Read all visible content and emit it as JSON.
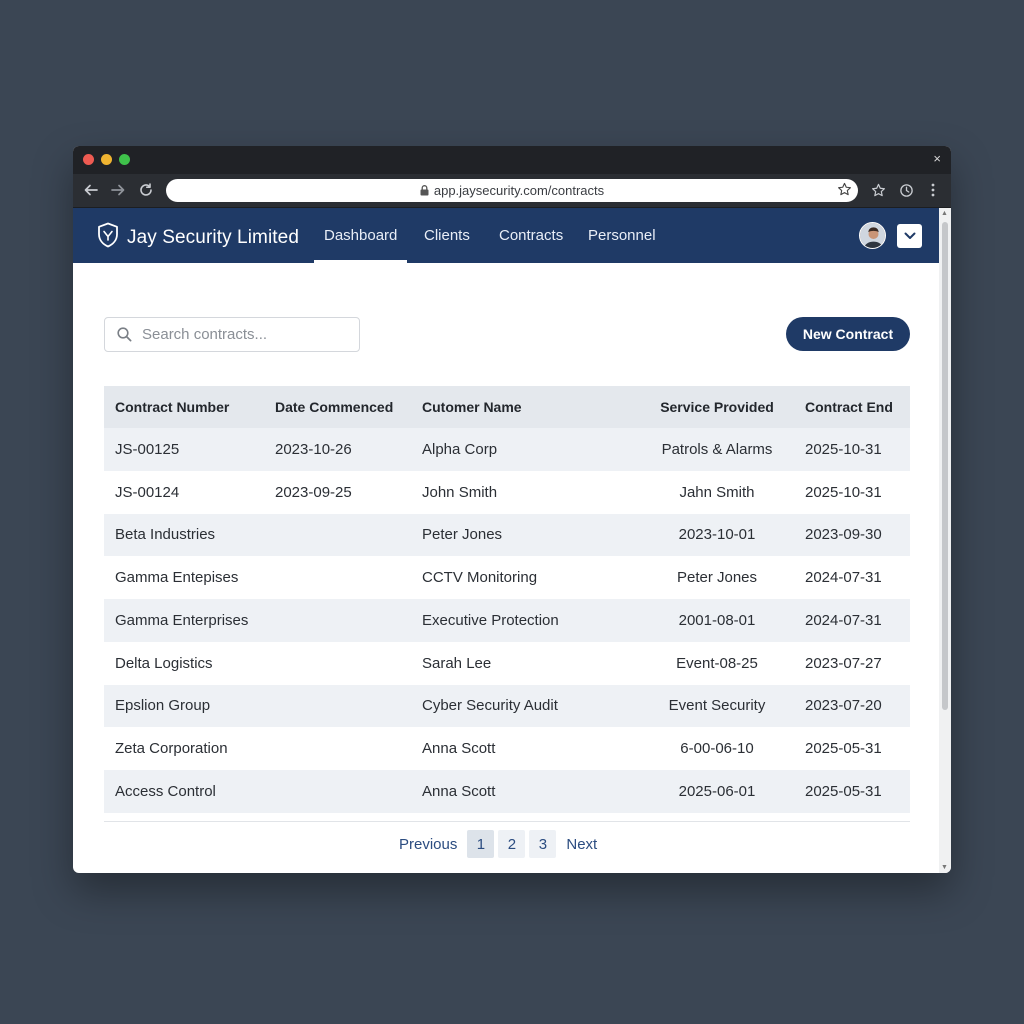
{
  "browser": {
    "url": "app.jaysecurity.com/contracts",
    "close_glyph": "×",
    "icons": [
      "back-arrow-icon",
      "forward-arrow-icon",
      "reload-icon",
      "lock-icon",
      "star-icon",
      "bookmark-star-icon",
      "history-icon",
      "kebab-menu-icon"
    ]
  },
  "navbar": {
    "brand": "Jay Security Limited",
    "links": [
      "Dashboard",
      "Clients",
      "Contracts",
      "Personnel"
    ],
    "active": "Dashboard"
  },
  "search": {
    "placeholder": "Search contracts..."
  },
  "actions": {
    "new_contract": "New Contract"
  },
  "table": {
    "headers": [
      "Contract Number",
      "Date Commenced",
      "Cutomer Name",
      "Service Provided",
      "Contract End"
    ],
    "rows": [
      [
        "JS-00125",
        "2023-10-26",
        "Alpha Corp",
        "Patrols & Alarms",
        "2025-10-31"
      ],
      [
        "JS-00124",
        "2023-09-25",
        "John Smith",
        "Jahn Smith",
        "2025-10-31"
      ],
      [
        "Beta Industries",
        "",
        "Peter Jones",
        "2023-10-01",
        "2023-09-30"
      ],
      [
        "Gamma Entepises",
        "",
        "CCTV Monitoring",
        "Peter Jones",
        "2024-07-31"
      ],
      [
        "Gamma Enterprises",
        "",
        "Executive Protection",
        "2001-08-01",
        "2024-07-31"
      ],
      [
        "Delta Logistics",
        "",
        "Sarah Lee",
        "Event-08-25",
        "2023-07-27"
      ],
      [
        "Epslion Group",
        "",
        "Cyber Security Audit",
        "Event Security",
        "2023-07-20"
      ],
      [
        "Zeta Corporation",
        "",
        "Anna Scott",
        "6-00-06-10",
        "2025-05-31"
      ],
      [
        "Access Control",
        "",
        "Anna Scott",
        "2025-06-01",
        "2025-05-31"
      ]
    ]
  },
  "pagination": {
    "previous": "Previous",
    "pages": [
      "1",
      "2",
      "3"
    ],
    "current": "1",
    "next": "Next"
  },
  "colors": {
    "navbar": "#1f3a66",
    "primary_button": "#1f3a66",
    "header_row": "#e4e8ed",
    "alt_row": "#eef1f5"
  }
}
